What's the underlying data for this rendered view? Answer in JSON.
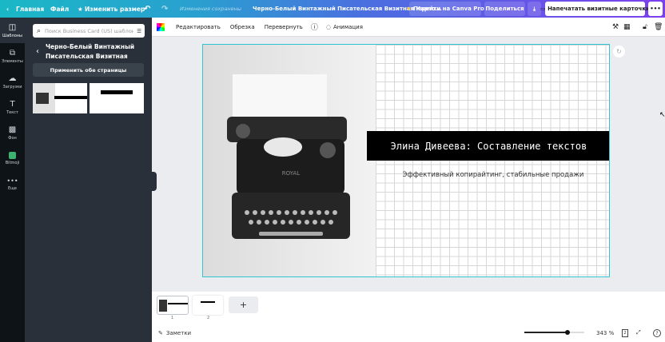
{
  "topbar": {
    "home": "Главная",
    "file": "Файл",
    "resize": "Изменить размер",
    "saved": "Изменения сохранены",
    "doc_title": "Черно-Белый Винтажный Писательская Визитная Карто...",
    "pro": "Перейти на Canva Pro",
    "share": "Поделиться",
    "print": "Напечатать визитные карточки",
    "more": "•••"
  },
  "rail": [
    {
      "label": "Шаблоны",
      "icon": "templates-icon"
    },
    {
      "label": "Элементы",
      "icon": "elements-icon"
    },
    {
      "label": "Загрузки",
      "icon": "upload-icon"
    },
    {
      "label": "Текст",
      "icon": "text-icon"
    },
    {
      "label": "Фон",
      "icon": "background-icon"
    },
    {
      "label": "Bitmoji",
      "icon": "bitmoji-icon"
    },
    {
      "label": "Еще",
      "icon": "more-icon"
    }
  ],
  "panel": {
    "search_placeholder": "Поиск Business Card (US) шаблон",
    "template_title": "Черно-Белый Винтажный Писательская Визитная Карточка",
    "apply_all": "Применить обе страницы"
  },
  "toolbar": {
    "edit": "Редактировать",
    "crop": "Обрезка",
    "flip": "Перевернуть",
    "animate": "Анимация"
  },
  "card": {
    "name": "Элина Дивеева: Составление текстов",
    "tagline": "Эффективный копирайтинг, стабильные продажи",
    "typewriter_brand": "ROYAL"
  },
  "pages": [
    {
      "num": "1"
    },
    {
      "num": "2"
    }
  ],
  "footer": {
    "notes": "Заметки",
    "zoom": "343 %",
    "zoom_level": 0.72,
    "page_count": "2",
    "help": "?"
  },
  "colors": {
    "accent": "#2ec4d0",
    "pro_star": "#f5c518"
  }
}
